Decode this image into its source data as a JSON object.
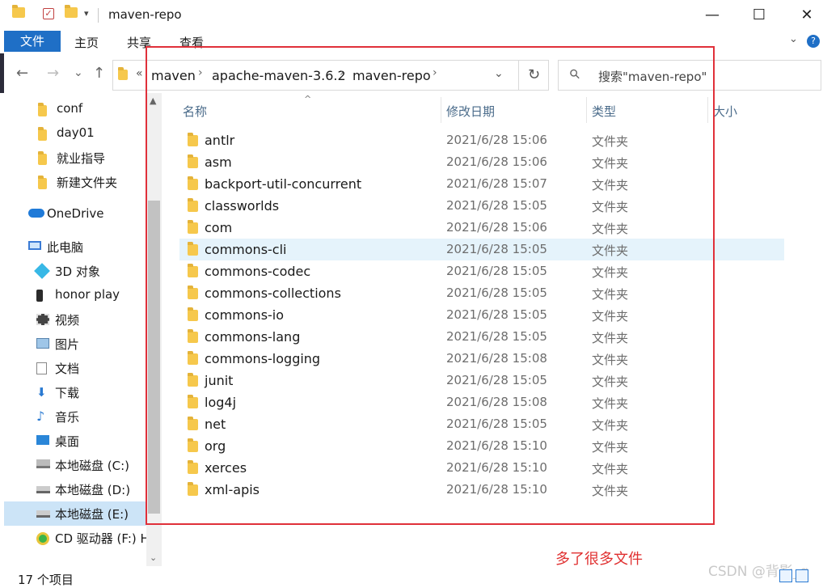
{
  "window": {
    "title": "maven-repo",
    "minimize": "—",
    "maximize": "☐",
    "close": "✕"
  },
  "ribbon": {
    "tabs": [
      "文件",
      "主页",
      "共享",
      "查看"
    ],
    "help": "?"
  },
  "address": {
    "overflow": "«",
    "crumbs": [
      "maven",
      "apache-maven-3.6.2",
      "maven-repo"
    ],
    "separator": "›",
    "dropdown": "⌄",
    "refresh": "↻"
  },
  "search": {
    "placeholder": "搜索\"maven-repo\""
  },
  "nav": {
    "back": "←",
    "forward": "→",
    "recent": "⌄",
    "up": "↑",
    "items": [
      {
        "label": "conf",
        "icon": "folder-icon"
      },
      {
        "label": "day01",
        "icon": "folder-icon"
      },
      {
        "label": "就业指导",
        "icon": "folder-icon"
      },
      {
        "label": "新建文件夹",
        "icon": "folder-icon"
      },
      {
        "label": "OneDrive",
        "icon": "cloud-icon"
      },
      {
        "label": "此电脑",
        "icon": "computer-icon"
      },
      {
        "label": "3D 对象",
        "icon": "cube-icon"
      },
      {
        "label": "honor play",
        "icon": "phone-icon"
      },
      {
        "label": "视频",
        "icon": "video-icon"
      },
      {
        "label": "图片",
        "icon": "picture-icon"
      },
      {
        "label": "文档",
        "icon": "document-icon"
      },
      {
        "label": "下载",
        "icon": "download-icon"
      },
      {
        "label": "音乐",
        "icon": "music-icon"
      },
      {
        "label": "桌面",
        "icon": "desktop-icon"
      },
      {
        "label": "本地磁盘 (C:)",
        "icon": "windows-drive-icon"
      },
      {
        "label": "本地磁盘 (D:)",
        "icon": "drive-icon"
      },
      {
        "label": "本地磁盘 (E:)",
        "icon": "drive-icon"
      },
      {
        "label": "CD 驱动器 (F:) H",
        "icon": "cd-drive-icon"
      }
    ],
    "selected_index": 16
  },
  "columns": {
    "name": "名称",
    "date": "修改日期",
    "type": "类型",
    "size": "大小"
  },
  "files": [
    {
      "name": "antlr",
      "date": "2021/6/28 15:06",
      "type": "文件夹"
    },
    {
      "name": "asm",
      "date": "2021/6/28 15:06",
      "type": "文件夹"
    },
    {
      "name": "backport-util-concurrent",
      "date": "2021/6/28 15:07",
      "type": "文件夹"
    },
    {
      "name": "classworlds",
      "date": "2021/6/28 15:05",
      "type": "文件夹"
    },
    {
      "name": "com",
      "date": "2021/6/28 15:06",
      "type": "文件夹"
    },
    {
      "name": "commons-cli",
      "date": "2021/6/28 15:05",
      "type": "文件夹"
    },
    {
      "name": "commons-codec",
      "date": "2021/6/28 15:05",
      "type": "文件夹"
    },
    {
      "name": "commons-collections",
      "date": "2021/6/28 15:05",
      "type": "文件夹"
    },
    {
      "name": "commons-io",
      "date": "2021/6/28 15:05",
      "type": "文件夹"
    },
    {
      "name": "commons-lang",
      "date": "2021/6/28 15:05",
      "type": "文件夹"
    },
    {
      "name": "commons-logging",
      "date": "2021/6/28 15:08",
      "type": "文件夹"
    },
    {
      "name": "junit",
      "date": "2021/6/28 15:05",
      "type": "文件夹"
    },
    {
      "name": "log4j",
      "date": "2021/6/28 15:08",
      "type": "文件夹"
    },
    {
      "name": "net",
      "date": "2021/6/28 15:05",
      "type": "文件夹"
    },
    {
      "name": "org",
      "date": "2021/6/28 15:10",
      "type": "文件夹"
    },
    {
      "name": "xerces",
      "date": "2021/6/28 15:10",
      "type": "文件夹"
    },
    {
      "name": "xml-apis",
      "date": "2021/6/28 15:10",
      "type": "文件夹"
    }
  ],
  "highlighted_index": 5,
  "status": {
    "count": "17 个项目"
  },
  "annotation": {
    "text": "多了很多文件",
    "color": "#e03030"
  },
  "watermark": "CSDN @背影_g",
  "colors": {
    "accent": "#1f6fc6",
    "selection": "#cce4f7",
    "hover": "#e5f3fb",
    "folder": "#f6c84c"
  }
}
